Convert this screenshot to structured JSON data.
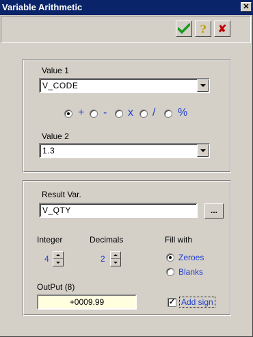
{
  "window": {
    "title": "Variable Arithmetic",
    "close_glyph": "✕"
  },
  "toolbar": {
    "ok_icon": "checkmark-icon",
    "help_glyph": "?",
    "cancel_glyph": "✘",
    "colors": {
      "ok": "#1a9a1a",
      "help": "#c0a000",
      "cancel": "#c00000"
    }
  },
  "operands": {
    "value1_label": "Value 1",
    "value1": "V_CODE",
    "operators": [
      "+",
      "-",
      "x",
      "/",
      "%"
    ],
    "selected_operator": "+",
    "value2_label": "Value 2",
    "value2": "1.3"
  },
  "result": {
    "result_var_label": "Result Var.",
    "result_var": "V_QTY",
    "browse_label": "...",
    "integer_label": "Integer",
    "integer_value": "4",
    "decimals_label": "Decimals",
    "decimals_value": "2",
    "fill_label": "Fill with",
    "fill_options": [
      "Zeroes",
      "Blanks"
    ],
    "fill_selected": "Zeroes",
    "output_label": "OutPut (8)",
    "output_value": "+0009.99",
    "add_sign_label": "Add sign",
    "add_sign_checked": true
  },
  "colors": {
    "title_bg": "#0a246a",
    "accent_text": "#1f3fd0",
    "output_bg": "#ffffe0"
  }
}
